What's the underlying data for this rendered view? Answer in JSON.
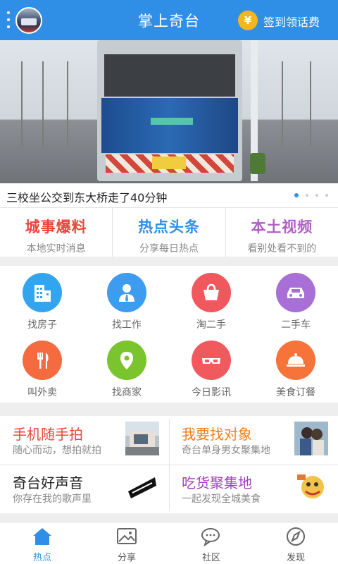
{
  "header": {
    "title": "掌上奇台",
    "coin_symbol": "¥",
    "signin_label": "签到领话费",
    "accent": "#2f8fe6"
  },
  "banner": {
    "caption": "三校坐公交到东大桥走了40分钟",
    "slides": 4,
    "active_slide": 1
  },
  "sections": [
    {
      "title": "城事爆料",
      "subtitle": "本地实时消息",
      "color": "#e8453c"
    },
    {
      "title": "热点头条",
      "subtitle": "分享每日热点",
      "color": "#2f8fe6"
    },
    {
      "title": "本土视频",
      "subtitle": "看别处看不到的",
      "color": "#b05fc5"
    }
  ],
  "grid": [
    {
      "label": "找房子",
      "icon": "building-icon",
      "color": "#33a4ee"
    },
    {
      "label": "找工作",
      "icon": "person-tie-icon",
      "color": "#3d9bf0"
    },
    {
      "label": "淘二手",
      "icon": "shopping-bag-icon",
      "color": "#f0585e"
    },
    {
      "label": "二手车",
      "icon": "car-icon",
      "color": "#a86fd6"
    },
    {
      "label": "叫外卖",
      "icon": "fork-knife-icon",
      "color": "#f56b3f"
    },
    {
      "label": "找商家",
      "icon": "location-pin-icon",
      "color": "#7ac42e"
    },
    {
      "label": "今日影讯",
      "icon": "3d-glasses-icon",
      "color": "#f05a5e"
    },
    {
      "label": "美食订餐",
      "icon": "dish-cover-icon",
      "color": "#f6733a"
    }
  ],
  "features": [
    {
      "title": "手机随手拍",
      "subtitle": "随心而动，想拍就拍",
      "color": "#e8453c",
      "thumb": "photo-hand-thumb"
    },
    {
      "title": "我要找对象",
      "subtitle": "奇台单身男女聚集地",
      "color": "#f07d16",
      "thumb": "couple-thumb"
    },
    {
      "title": "奇台好声音",
      "subtitle": "你存在我的歌声里",
      "color": "#222222",
      "thumb": "voice-logo-thumb"
    },
    {
      "title": "吃货聚集地",
      "subtitle": "一起发现全城美食",
      "color": "#a23fbf",
      "thumb": "foodie-cartoon-thumb"
    }
  ],
  "tabs": [
    {
      "label": "热点",
      "icon": "home-icon",
      "active": true
    },
    {
      "label": "分享",
      "icon": "image-icon",
      "active": false
    },
    {
      "label": "社区",
      "icon": "chat-bubbles-icon",
      "active": false
    },
    {
      "label": "发现",
      "icon": "compass-icon",
      "active": false
    }
  ]
}
